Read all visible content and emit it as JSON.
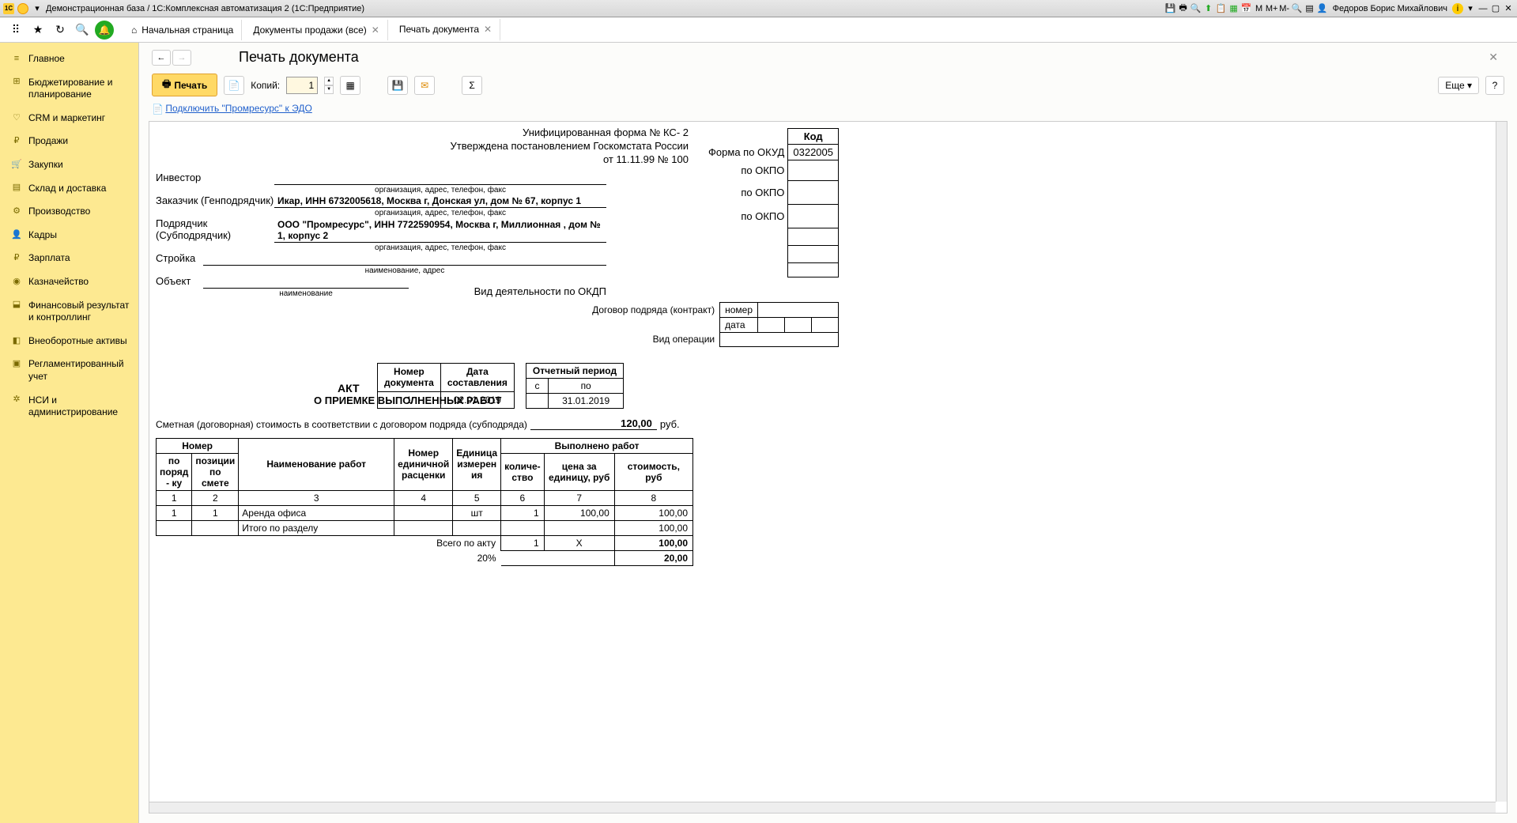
{
  "titlebar": {
    "logo": "1C",
    "title": "Демонстрационная база / 1С:Комплексная автоматизация 2  (1С:Предприятие)",
    "user_prefix": "▲",
    "user": "Федоров Борис Михайлович",
    "m_buttons": [
      "М",
      "М+",
      "М-"
    ]
  },
  "tabs": {
    "home": "Начальная страница",
    "t1": "Документы продажи (все)",
    "t2": "Печать документа"
  },
  "sidebar": [
    {
      "ico": "⌂",
      "label": "Главное"
    },
    {
      "ico": "⊞",
      "label": "Бюджетирование и планирование"
    },
    {
      "ico": "♡",
      "label": "CRM и маркетинг"
    },
    {
      "ico": "₽",
      "label": "Продажи"
    },
    {
      "ico": "🛒",
      "label": "Закупки"
    },
    {
      "ico": "≣",
      "label": "Склад и доставка"
    },
    {
      "ico": "⚙",
      "label": "Производство"
    },
    {
      "ico": "👤",
      "label": "Кадры"
    },
    {
      "ico": "₽",
      "label": "Зарплата"
    },
    {
      "ico": "◉",
      "label": "Казначейство"
    },
    {
      "ico": "⬓",
      "label": "Финансовый результат и контроллинг"
    },
    {
      "ico": "◧",
      "label": "Внеоборотные активы"
    },
    {
      "ico": "▣",
      "label": "Регламентированный учет"
    },
    {
      "ico": "✲",
      "label": "НСИ и администрирование"
    }
  ],
  "page": {
    "title": "Печать документа",
    "print_btn": "Печать",
    "copies_label": "Копий:",
    "copies_value": "1",
    "more": "Еще",
    "help": "?",
    "edo_link": "Подключить \"Промресурс\" к ЭДО"
  },
  "doc": {
    "form_line1": "Унифицированная форма № КС- 2",
    "form_line2": "Утверждена постановлением Госкомстата России",
    "form_line3": "от 11.11.99 № 100",
    "kod_header": "Код",
    "okud_label": "Форма по ОКУД",
    "okud_val": "0322005",
    "okpo": "по ОКПО",
    "investor_lbl": "Инвестор",
    "customer_lbl": "Заказчик (Генподрядчик)",
    "customer_val": "Икар, ИНН 6732005618, Москва г, Донская ул, дом № 67, корпус 1",
    "contractor_lbl": "Подрядчик (Субподрядчик)",
    "contractor_val": "ООО \"Промресурс\", ИНН 7722590954, Москва г, Миллионная , дом № 1, корпус 2",
    "org_hint": "организация, адрес, телефон, факс",
    "build_lbl": "Стройка",
    "build_hint": "наименование, адрес",
    "object_lbl": "Объект",
    "object_hint": "наименование",
    "okdp_lbl": "Вид деятельности по ОКДП",
    "contract_lbl": "Договор подряда (контракт)",
    "contract_num_lbl": "номер",
    "contract_date_lbl": "дата",
    "op_type_lbl": "Вид операции",
    "docnum_h1": "Номер",
    "docnum_h2": "документа",
    "docdate_h1": "Дата",
    "docdate_h2": "составления",
    "docnum_v": "1",
    "docdate_v": "02.01.2019",
    "period_h": "Отчетный период",
    "period_from": "с",
    "period_to": "по",
    "period_to_v": "31.01.2019",
    "act": "АКТ",
    "act_sub": "О ПРИЕМКЕ ВЫПОЛНЕННЫХ РАБОТ",
    "estimate_lbl": "Сметная (договорная) стоимость в соответствии с договором подряда (субподряда)",
    "estimate_val": "120,00",
    "estimate_unit": "руб.",
    "tbl": {
      "h_num": "Номер",
      "h_order": "по поряд - ку",
      "h_pos": "позиции по смете",
      "h_name": "Наименование работ",
      "h_pricenum": "Номер единичной расценки",
      "h_unit": "Единица измерен ия",
      "h_done": "Выполнено работ",
      "h_qty": "количе- ство",
      "h_price": "цена за единицу, руб",
      "h_cost": "стоимость,  руб",
      "cols": [
        "1",
        "2",
        "3",
        "4",
        "5",
        "6",
        "7",
        "8"
      ],
      "row1": {
        "n": "1",
        "pos": "1",
        "name": "Аренда офиса",
        "unit": "шт",
        "qty": "1",
        "price": "100,00",
        "cost": "100,00"
      },
      "subtotal": "Итого по разделу",
      "subtotal_cost": "100,00",
      "total_lbl": "Всего по акту",
      "total_qty": "1",
      "total_x": "X",
      "total_cost": "100,00",
      "vat_lbl": "20%",
      "vat_val": "20,00"
    }
  }
}
